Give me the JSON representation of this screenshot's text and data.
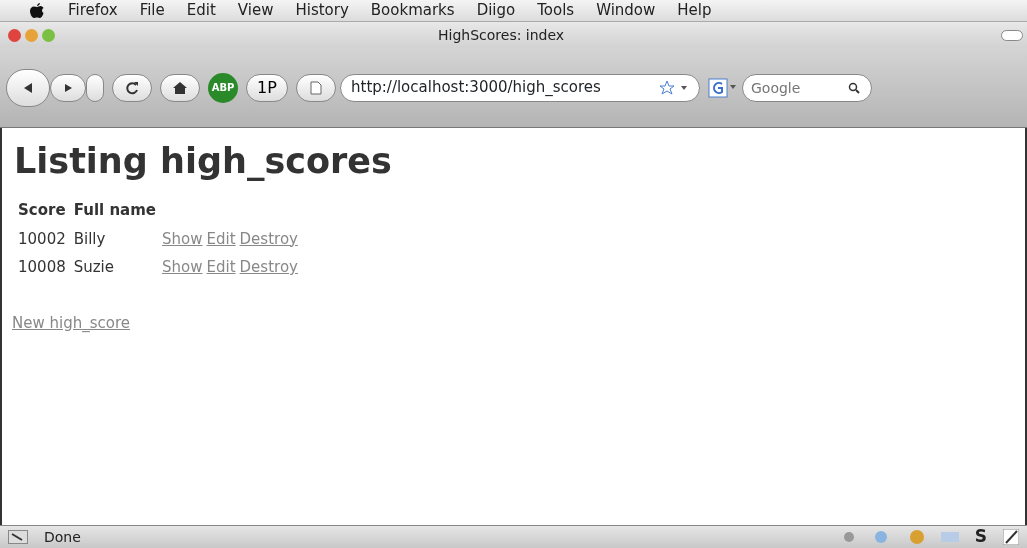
{
  "menu_bar": [
    "Firefox",
    "File",
    "Edit",
    "View",
    "History",
    "Bookmarks",
    "Diigo",
    "Tools",
    "Window",
    "Help"
  ],
  "window": {
    "title": "HighScores: index"
  },
  "toolbar": {
    "abp": "ABP",
    "onep": "1P",
    "url": "http://localhost:3000/high_scores",
    "search_placeholder": "Google"
  },
  "page": {
    "heading": "Listing high_scores",
    "table": {
      "columns": [
        "Score",
        "Full name"
      ],
      "rows": [
        {
          "score": "10002",
          "full_name": "Billy",
          "actions": [
            "Show",
            "Edit",
            "Destroy"
          ]
        },
        {
          "score": "10008",
          "full_name": "Suzie",
          "actions": [
            "Show",
            "Edit",
            "Destroy"
          ]
        }
      ]
    },
    "new_link": "New high_score"
  },
  "status_bar": {
    "text": "Done",
    "s_label": "S"
  }
}
